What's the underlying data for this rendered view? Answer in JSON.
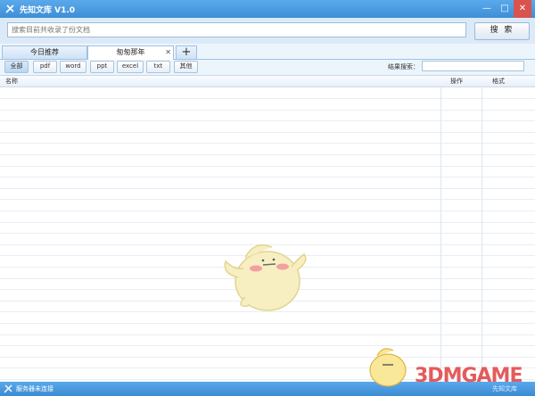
{
  "window": {
    "title": "先知文库 V1.0",
    "minimize": "—",
    "maximize": "□",
    "close": "✕"
  },
  "search": {
    "placeholder": "搜索目前共收录了份文档",
    "button_label": "搜 索"
  },
  "tabs": [
    {
      "label": "今日推荐"
    },
    {
      "label": "匆匆那年",
      "close": "✕"
    }
  ],
  "tab_add_label": "+",
  "filters": [
    {
      "label": "全部",
      "selected": true
    },
    {
      "label": "pdf"
    },
    {
      "label": "word"
    },
    {
      "label": "ppt"
    },
    {
      "label": "excel"
    },
    {
      "label": "txt"
    },
    {
      "label": "其他"
    }
  ],
  "result_search": {
    "label": "结果搜索：",
    "value": ""
  },
  "table": {
    "columns": [
      "名称",
      "操作",
      "格式"
    ],
    "rows": []
  },
  "status": {
    "text": "服务器未连接",
    "right": "先知文库"
  },
  "watermark": {
    "text": "3DMGAME"
  },
  "colors": {
    "accent": "#3f92d8",
    "grid": "#e8eef4",
    "watermark": "#e24a4a"
  }
}
